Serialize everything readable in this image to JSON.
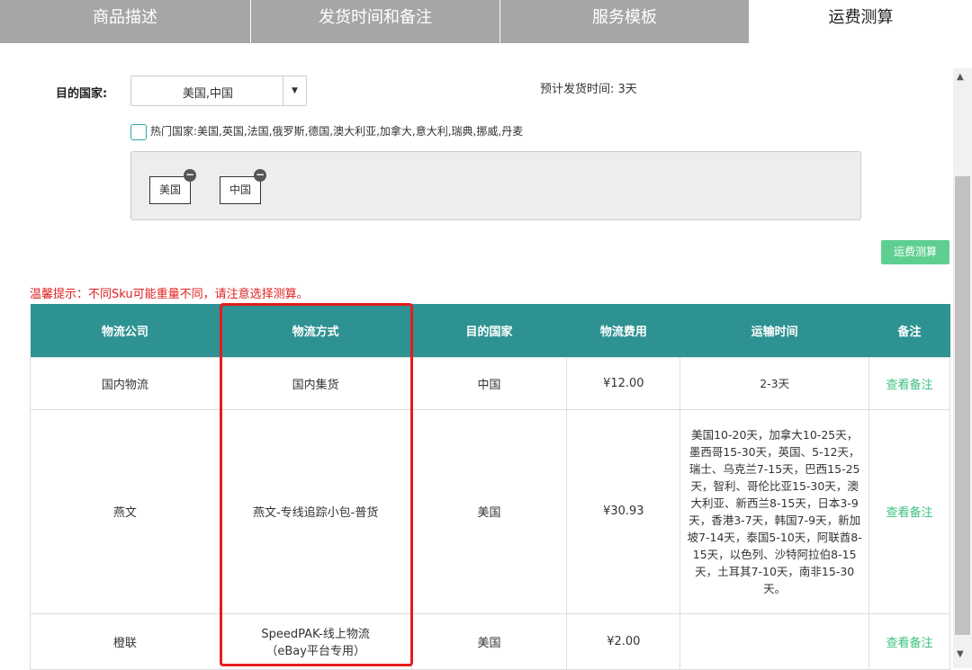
{
  "tabs": [
    "商品描述",
    "发货时间和备注",
    "服务模板",
    "运费测算"
  ],
  "form": {
    "country_label": "目的国家:",
    "country_value": "美国,中国",
    "eta": "预计发货时间: 3天",
    "hot_countries": "热门国家:美国,英国,法国,俄罗斯,德国,澳大利亚,加拿大,意大利,瑞典,挪威,丹麦",
    "chips": [
      "美国",
      "中国"
    ],
    "calc_button": "运费测算"
  },
  "tip": "温馨提示：不同Sku可能重量不同，请注意选择测算。",
  "table": {
    "headers": [
      "物流公司",
      "物流方式",
      "目的国家",
      "物流费用",
      "运输时间",
      "备注"
    ],
    "rows": [
      {
        "company": "国内物流",
        "method": "国内集货",
        "country": "中国",
        "fee": "¥12.00",
        "transit": "2-3天",
        "note": "查看备注"
      },
      {
        "company": "燕文",
        "method": "燕文-专线追踪小包-普货",
        "country": "美国",
        "fee": "¥30.93",
        "transit": "美国10-20天，加拿大10-25天，墨西哥15-30天，英国、5-12天，瑞士、乌克兰7-15天，巴西15-25天，智利、哥伦比亚15-30天，澳大利亚、新西兰8-15天，日本3-9天，香港3-7天，韩国7-9天，新加坡7-14天，泰国5-10天，阿联酋8-15天，以色列、沙特阿拉伯8-15天，土耳其7-10天，南非15-30天。",
        "note": "查看备注"
      },
      {
        "company": "橙联",
        "method": "SpeedPAK-线上物流（eBay平台专用）",
        "country": "美国",
        "fee": "¥2.00",
        "transit": "",
        "note": "查看备注"
      }
    ]
  },
  "colors": {
    "header_bg": "#2f9292",
    "accent_green": "#5fcf91",
    "note_link": "#3cc07f",
    "tip_red": "#e02020",
    "highlight_box": "#e51c1c"
  }
}
